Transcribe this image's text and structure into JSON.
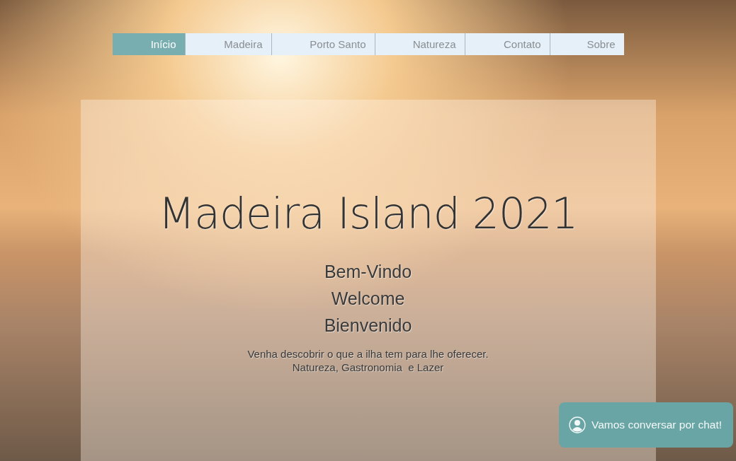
{
  "nav": {
    "items": [
      {
        "label": "Início",
        "selected": true
      },
      {
        "label": "Madeira",
        "selected": false
      },
      {
        "label": "Porto Santo",
        "selected": false
      },
      {
        "label": "Natureza",
        "selected": false
      },
      {
        "label": "Contato",
        "selected": false
      },
      {
        "label": "Sobre",
        "selected": false
      }
    ]
  },
  "hero": {
    "title": "Madeira Island 2021",
    "greetings": [
      "Bem-Vindo",
      "Welcome",
      "Bienvenido"
    ],
    "tagline": [
      "Venha descobrir o que a ilha tem para lhe oferecer.",
      "Natureza, Gastronomia  e Lazer"
    ]
  },
  "chat_button": {
    "label": "Vamos conversar por chat!"
  }
}
